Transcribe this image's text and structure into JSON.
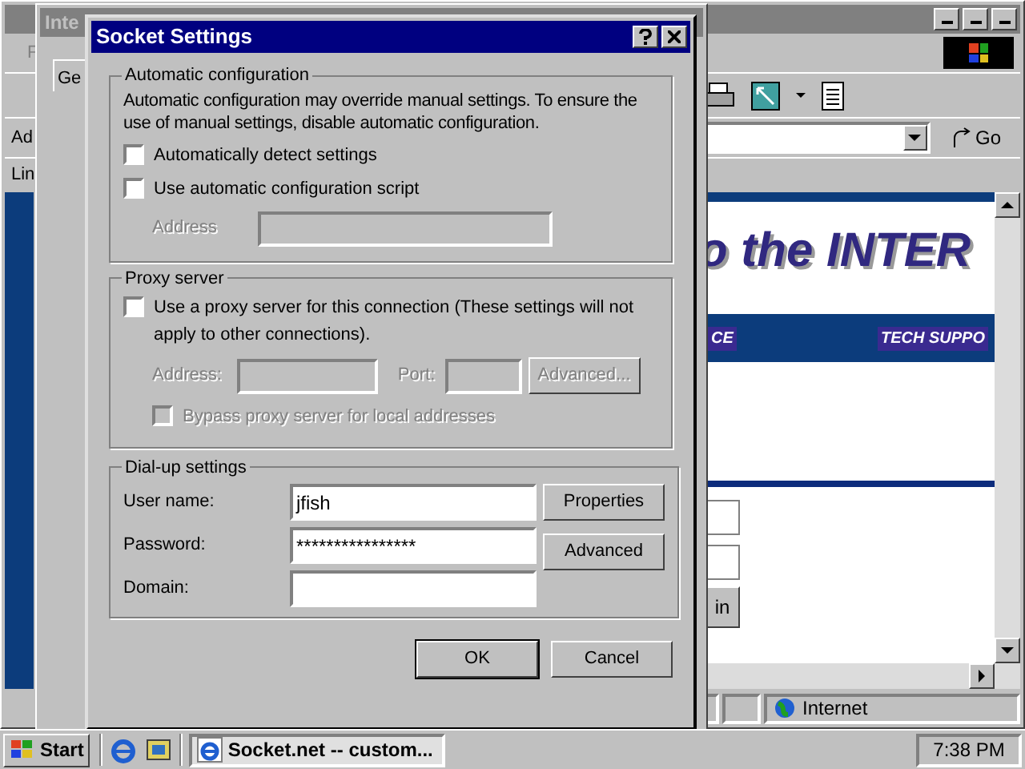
{
  "browser": {
    "menu_fragment": "F",
    "address_label": "Ad",
    "links_label": "Lin",
    "go": "Go",
    "banner": "o the INTER",
    "nav": [
      "CE",
      "TECH SUPPO"
    ],
    "button_fragment": "in",
    "status_zone": "Internet"
  },
  "options_dialog": {
    "title": "Inte",
    "tab": "Ge"
  },
  "dialog": {
    "title": "Socket Settings",
    "auto": {
      "legend": "Automatic configuration",
      "text": "Automatic configuration may override manual settings.  To ensure the use of manual settings, disable automatic configuration.",
      "options": [
        {
          "label": "Automatically detect settings",
          "checked": false
        },
        {
          "label": "Use automatic configuration script",
          "checked": false
        }
      ],
      "address": {
        "label": "Address",
        "disabled": true
      }
    },
    "proxy": {
      "legend": "Proxy server",
      "checkbox": {
        "label": "Use a proxy server for this connection (These settings will not apply to other connections).",
        "checked": false
      },
      "fields": [
        {
          "label": "Address:",
          "disabled": true
        },
        {
          "label": "Port:",
          "disabled": true
        }
      ],
      "advanced": {
        "label": "Advanced...",
        "disabled": true
      },
      "bypass": {
        "label": "Bypass proxy server for local addresses",
        "checked": false,
        "disabled": true
      }
    },
    "dialup": {
      "legend": "Dial-up settings",
      "fields": [
        {
          "label": "User name:",
          "value": "jfish"
        },
        {
          "label": "Password:",
          "value": "****************"
        },
        {
          "label": "Domain:"
        }
      ],
      "buttons": [
        "Properties",
        "Advanced"
      ]
    },
    "buttons": [
      "OK",
      "Cancel"
    ]
  },
  "taskbar": {
    "start": "Start",
    "task": "Socket.net -- custom...",
    "clock": "7:38 PM"
  }
}
